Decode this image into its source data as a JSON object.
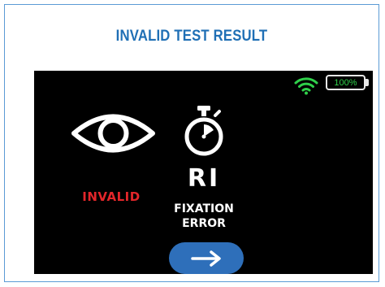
{
  "title": "INVALID TEST RESULT",
  "status_bar": {
    "wifi_icon": "wifi-icon",
    "battery_label": "100%",
    "battery_level": 1.0
  },
  "result": {
    "eye_icon": "eye-icon",
    "eye_status": "INVALID",
    "eye_status_color": "#e3262a",
    "timer_icon": "stopwatch-icon",
    "code": "RI",
    "message_line1": "FIXATION",
    "message_line2": "ERROR"
  },
  "next_button": {
    "icon": "arrow-right-icon",
    "color": "#2e6fba"
  },
  "colors": {
    "title": "#1f6fb5",
    "frame_border": "#5b9bd5",
    "screen_bg": "#000000",
    "wifi": "#2fd04a",
    "battery_text": "#2fd04a"
  }
}
